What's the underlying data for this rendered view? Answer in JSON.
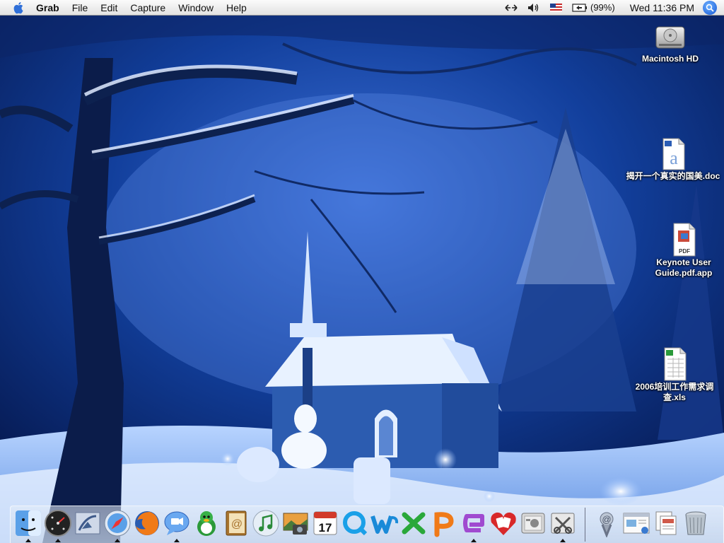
{
  "menubar": {
    "app_name": "Grab",
    "menus": [
      "File",
      "Edit",
      "Capture",
      "Window",
      "Help"
    ],
    "battery_text": "(99%)",
    "clock": "Wed 11:36 PM"
  },
  "desktop": {
    "icons": [
      {
        "label": "Macintosh HD",
        "icon": "hard-drive-icon"
      },
      {
        "label": "揭开一个真实的国美.doc",
        "icon": "word-document-icon"
      },
      {
        "label_lines": [
          "Keynote User",
          "Guide.pdf.app"
        ],
        "icon": "pdf-icon"
      },
      {
        "label_lines": [
          "2006培训工作需求调",
          "查.xls"
        ],
        "icon": "excel-document-icon"
      }
    ]
  },
  "dock": {
    "apps": [
      {
        "name": "finder-icon",
        "running": true
      },
      {
        "name": "dashboard-icon",
        "running": true
      },
      {
        "name": "mail-icon",
        "running": false
      },
      {
        "name": "safari-icon",
        "running": true
      },
      {
        "name": "firefox-icon",
        "running": false
      },
      {
        "name": "ichat-icon",
        "running": true
      },
      {
        "name": "qq-icon",
        "running": false
      },
      {
        "name": "address-book-icon",
        "running": false
      },
      {
        "name": "itunes-icon",
        "running": false
      },
      {
        "name": "iphoto-icon",
        "running": false
      },
      {
        "name": "ical-icon",
        "running": false,
        "date": "17"
      },
      {
        "name": "office-q-icon",
        "running": false
      },
      {
        "name": "word-icon",
        "running": false
      },
      {
        "name": "excel-icon",
        "running": false
      },
      {
        "name": "powerpoint-icon",
        "running": false
      },
      {
        "name": "entourage-icon",
        "running": true
      },
      {
        "name": "solitaire-icon",
        "running": false
      },
      {
        "name": "system-prefs-icon",
        "running": false
      },
      {
        "name": "grab-icon",
        "running": true
      }
    ],
    "extras": [
      "downloads-stack-icon",
      "web-document-icon",
      "document-stack-icon",
      "trash-icon"
    ]
  },
  "colors": {
    "sky": "#0d2f86",
    "snow": "#e8f2ff",
    "church": "#2a5aa8"
  }
}
